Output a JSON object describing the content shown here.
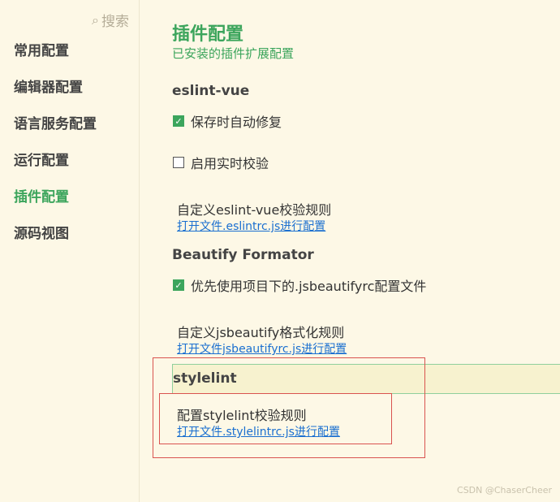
{
  "sidebar": {
    "search_label": "搜索",
    "items": [
      {
        "label": "常用配置"
      },
      {
        "label": "编辑器配置"
      },
      {
        "label": "语言服务配置"
      },
      {
        "label": "运行配置"
      },
      {
        "label": "插件配置",
        "active": true
      },
      {
        "label": "源码视图"
      }
    ]
  },
  "main": {
    "title": "插件配置",
    "subtitle": "已安装的插件扩展配置",
    "eslint": {
      "title": "eslint-vue",
      "auto_fix_label": "保存时自动修复",
      "auto_fix_checked": true,
      "realtime_label": "启用实时校验",
      "realtime_checked": false,
      "rule_label": "自定义eslint-vue校验规则",
      "rule_link": "打开文件.eslintrc.js进行配置"
    },
    "beautify": {
      "title": "Beautify Formator",
      "prefer_label": "优先使用项目下的.jsbeautifyrc配置文件",
      "prefer_checked": true,
      "rule_label": "自定义jsbeautify格式化规则",
      "rule_link": "打开文件jsbeautifyrc.js进行配置"
    },
    "stylelint": {
      "title": "stylelint",
      "rule_label": "配置stylelint校验规则",
      "rule_link": "打开文件.stylelintrc.js进行配置"
    }
  },
  "watermark": "CSDN @ChaserCheer",
  "colors": {
    "accent": "#3ca55c",
    "link": "#1a6fd0",
    "background": "#fdf8e6",
    "highlight_border": "#d9534f"
  }
}
